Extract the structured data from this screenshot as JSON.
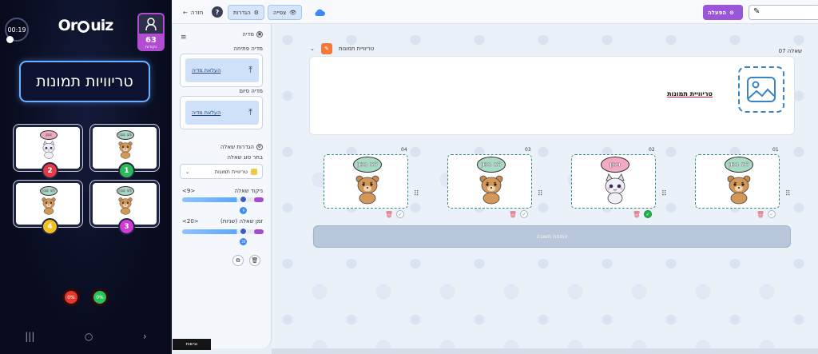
{
  "phone": {
    "timer": "00:19",
    "logo": [
      "Or",
      "uiz"
    ],
    "user": {
      "score": "63",
      "points_label": "נקודות"
    },
    "title": "טריוויות תמונות",
    "answers": [
      {
        "number": "1",
        "color": "#2db85a",
        "bubble": "לא נכון"
      },
      {
        "number": "2",
        "color": "#e33a48",
        "bubble": "נכון"
      },
      {
        "number": "3",
        "color": "#d23ad6",
        "bubble": "לא נכון"
      },
      {
        "number": "4",
        "color": "#f2c01e",
        "bubble": "לא נכון"
      }
    ],
    "percents": [
      {
        "label": "0%",
        "color": "#e3382f"
      },
      {
        "label": "0%",
        "color": "#27c25a"
      }
    ],
    "nav_icons": [
      "|||",
      "○",
      "›"
    ]
  },
  "toolbar": {
    "back": "חזרה",
    "settings": "הגדרות",
    "preview": "צפייה",
    "start": "הפעלה"
  },
  "panel": {
    "media": "מדיה",
    "opening_media": "מדיה פתיחה",
    "upload_label": "העלאת מדיה",
    "closing_media": "מדיה סיום",
    "question_settings": "הגדרות שאלה",
    "choose_type": "בחר סוג שאלה",
    "question_type": "טריוויית תמונות",
    "score_label": "ניקוד שאלה",
    "score_value": "9",
    "score_fill": 0.78,
    "time_label": "זמן שאלה (שניות)",
    "time_value": "20",
    "time_fill": 0.78,
    "bottom_pill": "נגישות"
  },
  "question": {
    "number": "שאלה 07",
    "type_label": "טריוויית תמונות",
    "text": "טריוויית תמונות",
    "answers": [
      {
        "id": "01",
        "bubble": "לא נכון",
        "animal": "bear",
        "correct": false
      },
      {
        "id": "02",
        "bubble": "נכון",
        "animal": "cat",
        "correct": true
      },
      {
        "id": "03",
        "bubble": "לא נכון",
        "animal": "bear",
        "correct": false
      },
      {
        "id": "04",
        "bubble": "לא נכון",
        "animal": "bear",
        "correct": false
      }
    ],
    "add_answer": "הוספת תשובה"
  },
  "colors": {
    "accent": "#9a55d9",
    "phone_bg": "#080b1c",
    "correct": "#22b14c",
    "answer_border": "#3a8a85"
  }
}
